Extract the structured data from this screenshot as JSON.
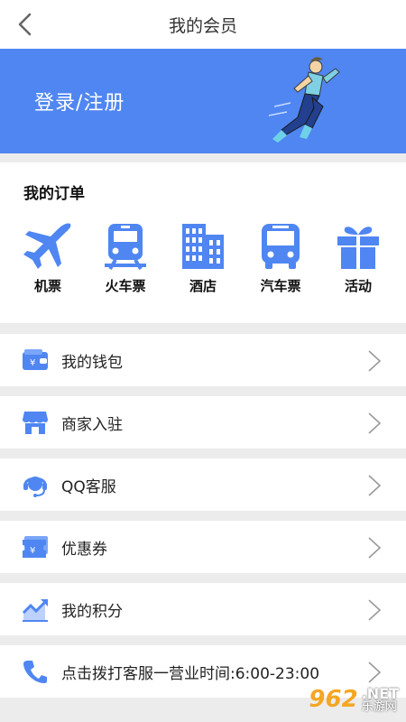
{
  "header": {
    "title": "我的会员",
    "back_icon": "chevron-left-icon"
  },
  "banner": {
    "login_label": "登录/注册",
    "bg_color": "#4f86f2"
  },
  "orders": {
    "title": "我的订单",
    "items": [
      {
        "label": "机票",
        "icon": "airplane-icon"
      },
      {
        "label": "火车票",
        "icon": "train-icon"
      },
      {
        "label": "酒店",
        "icon": "hotel-icon"
      },
      {
        "label": "汽车票",
        "icon": "bus-icon"
      },
      {
        "label": "活动",
        "icon": "gift-icon"
      }
    ],
    "icon_color": "#4f86f2"
  },
  "menu": {
    "items": [
      {
        "label": "我的钱包",
        "icon": "wallet-icon"
      },
      {
        "label": "商家入驻",
        "icon": "store-icon"
      },
      {
        "label": "QQ客服",
        "icon": "headset-icon"
      },
      {
        "label": "优惠券",
        "icon": "coupon-icon"
      },
      {
        "label": "我的积分",
        "icon": "chart-icon"
      },
      {
        "label": "点击拨打客服一营业时间:6:00-23:00",
        "icon": "phone-icon"
      }
    ]
  },
  "watermark": {
    "logo": "962",
    "net": ".NET",
    "sub": "乐游网"
  }
}
